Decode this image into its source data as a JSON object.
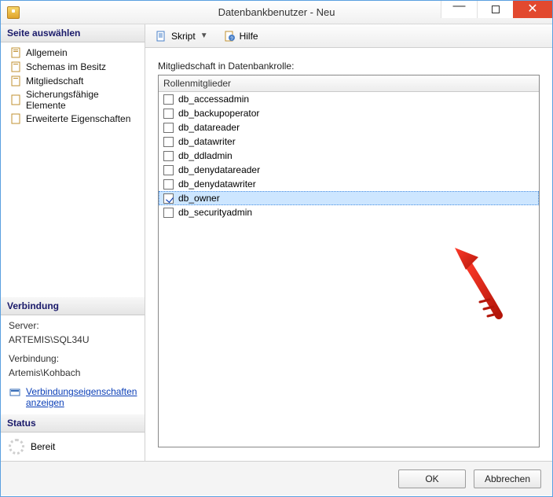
{
  "window": {
    "title": "Datenbankbenutzer - Neu"
  },
  "sidebar": {
    "select_page": "Seite auswählen",
    "items": [
      {
        "label": "Allgemein"
      },
      {
        "label": "Schemas im Besitz"
      },
      {
        "label": "Mitgliedschaft"
      },
      {
        "label": "Sicherungsfähige Elemente"
      },
      {
        "label": "Erweiterte Eigenschaften"
      }
    ],
    "connection_head": "Verbindung",
    "server_label": "Server:",
    "server_value": "ARTEMIS\\SQL34U",
    "conn_label": "Verbindung:",
    "conn_value": "Artemis\\Kohbach",
    "conn_link": "Verbindungseigenschaften anzeigen",
    "status_head": "Status",
    "status_value": "Bereit"
  },
  "toolbar": {
    "script": "Skript",
    "help": "Hilfe"
  },
  "main": {
    "group_label": "Mitgliedschaft in Datenbankrolle:",
    "column_header": "Rollenmitglieder",
    "roles": [
      {
        "label": "db_accessadmin",
        "checked": false
      },
      {
        "label": "db_backupoperator",
        "checked": false
      },
      {
        "label": "db_datareader",
        "checked": false
      },
      {
        "label": "db_datawriter",
        "checked": false
      },
      {
        "label": "db_ddladmin",
        "checked": false
      },
      {
        "label": "db_denydatareader",
        "checked": false
      },
      {
        "label": "db_denydatawriter",
        "checked": false
      },
      {
        "label": "db_owner",
        "checked": true,
        "selected": true
      },
      {
        "label": "db_securityadmin",
        "checked": false
      }
    ]
  },
  "footer": {
    "ok": "OK",
    "cancel": "Abbrechen"
  }
}
